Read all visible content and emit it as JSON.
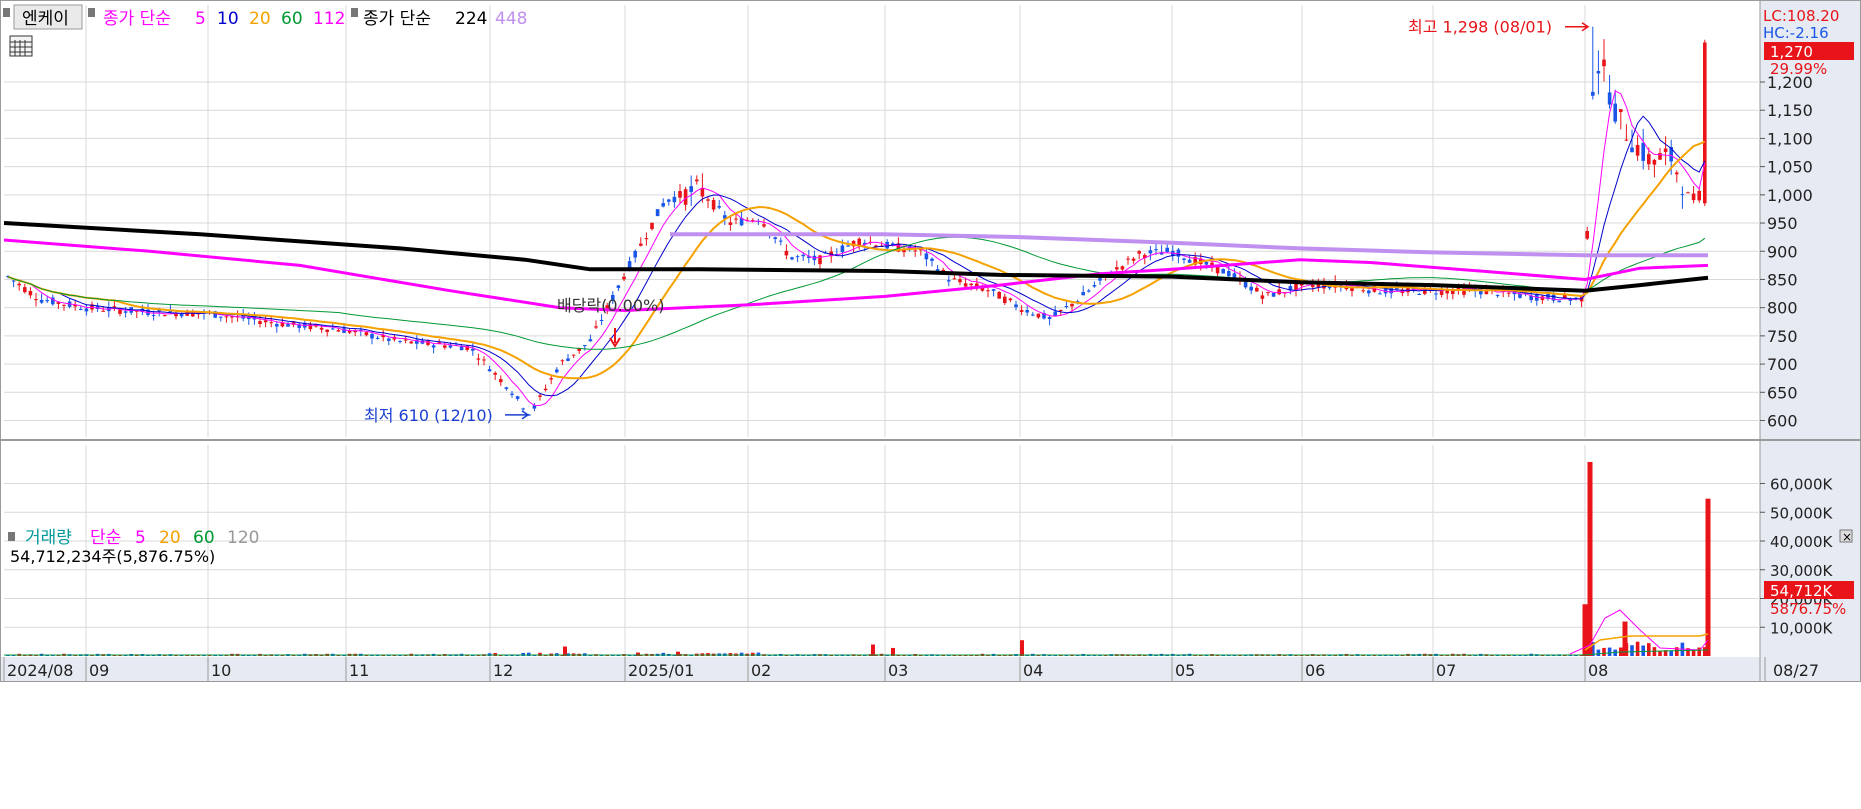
{
  "stock_name": "엔케이",
  "price_legend": {
    "prefix": "종가 단순",
    "ma_periods": [
      "5",
      "10",
      "20",
      "60",
      "112"
    ],
    "ma_colors": [
      "#ff00ff",
      "#0000cc",
      "#f5a200",
      "#009933",
      "#ff00ff"
    ],
    "prefix2": "종가 단순",
    "long_periods": [
      "224",
      "448"
    ],
    "long_colors": [
      "#000000",
      "#c090f0"
    ]
  },
  "volume_legend": {
    "label": "거래량",
    "prefix": "단순",
    "ma_periods": [
      "5",
      "20",
      "60",
      "120"
    ],
    "ma_colors": [
      "#ff00ff",
      "#f5a200",
      "#009933",
      "#999999"
    ],
    "current_text": "54,712,234주(5,876.75%)"
  },
  "right_info": {
    "lc": "LC:108.20",
    "hc": "HC:-2.16",
    "price_badge": "1,270",
    "price_change": "29.99%",
    "volume_badge": "54,712K",
    "volume_change": "5876.75%"
  },
  "annotations": {
    "high": "최고 1,298 (08/01)",
    "low": "최저 610 (12/10)",
    "dividend": "배당락(0.00%)"
  },
  "x_axis": {
    "labels": [
      "2024/08",
      "09",
      "10",
      "11",
      "12",
      "2025/01",
      "02",
      "03",
      "04",
      "05",
      "06",
      "07",
      "08"
    ],
    "date_badge": "08/27"
  },
  "colors": {
    "up": "#e8141a",
    "down": "#1a56e8",
    "grid": "#d9d9d9",
    "axis_bg": "#e6eaf2"
  },
  "chart_data": [
    {
      "type": "candlestick",
      "period": "2024/08 – 2025/08/27",
      "ylim": [
        575,
        1330
      ],
      "y_ticks": [
        600,
        650,
        700,
        750,
        800,
        850,
        900,
        950,
        1000,
        1050,
        1100,
        1150,
        1200
      ],
      "monthly_anchor_closes": [
        {
          "month": "2024/08",
          "close": 835
        },
        {
          "month": "09",
          "close": 790
        },
        {
          "month": "10",
          "close": 790
        },
        {
          "month": "11",
          "close": 745
        },
        {
          "month": "12",
          "close": 700
        },
        {
          "month": "2025/01",
          "close": 950
        },
        {
          "month": "02",
          "close": 890
        },
        {
          "month": "03",
          "close": 880
        },
        {
          "month": "04",
          "close": 810
        },
        {
          "month": "05",
          "close": 900
        },
        {
          "month": "06",
          "close": 840
        },
        {
          "month": "07",
          "close": 825
        },
        {
          "month": "08",
          "close": 1270
        }
      ],
      "high": 1298,
      "low": 610,
      "last_close": 1270,
      "series": [
        {
          "name": "5"
        },
        {
          "name": "10"
        },
        {
          "name": "20"
        },
        {
          "name": "60"
        },
        {
          "name": "112"
        },
        {
          "name": "224"
        },
        {
          "name": "448"
        }
      ]
    },
    {
      "type": "bar",
      "title": "거래량",
      "ylim": [
        0,
        70000
      ],
      "y_ticks": [
        "10,000K",
        "20,000K",
        "30,000K",
        "40,000K",
        "50,000K",
        "60,000K"
      ],
      "spikes_k": [
        {
          "date": "08/01",
          "value": 67500
        },
        {
          "date": "07/31",
          "value": 18000
        },
        {
          "date": "08/04",
          "value": 12000
        },
        {
          "date": "08/27",
          "value": 54712
        }
      ],
      "series": [
        {
          "name": "5"
        },
        {
          "name": "20"
        },
        {
          "name": "60"
        },
        {
          "name": "120"
        }
      ]
    }
  ]
}
